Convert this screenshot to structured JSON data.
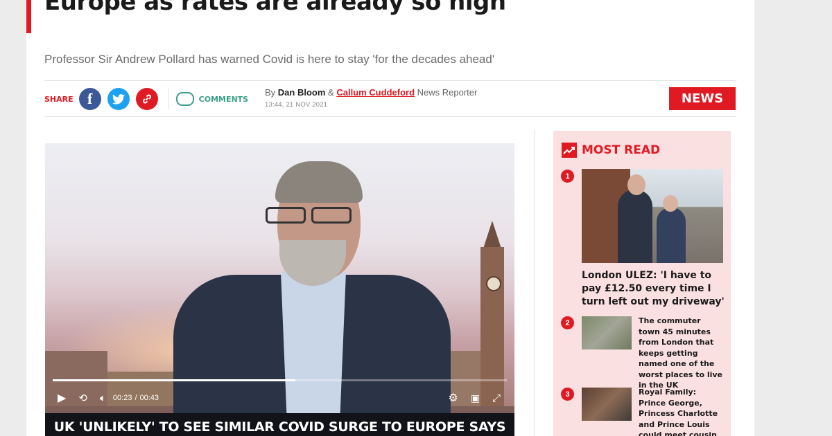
{
  "article": {
    "headline": "Europe as rates are already so high",
    "standfirst": "Professor Sir Andrew Pollard has warned Covid is here to stay 'for the decades ahead'",
    "share_label": "SHARE",
    "comments_label": "COMMENTS",
    "byline": {
      "prefix": "By",
      "author1": "Dan Bloom",
      "amp": "&",
      "author2": "Callum Cuddeford",
      "role": "News Reporter",
      "timestamp": "13:44, 21 NOV 2021"
    },
    "section_badge": "NEWS"
  },
  "video": {
    "current_time": "00:23",
    "separator": "/",
    "duration": "00:43",
    "progress": 0.535,
    "caption": "UK 'UNLIKELY' TO SEE SIMILAR COVID SURGE TO EUROPE SAYS",
    "icons": [
      "play-icon",
      "replay-10-icon",
      "volume-icon",
      "settings-icon",
      "picture-in-picture-icon",
      "fullscreen-icon"
    ]
  },
  "most_read": {
    "title": "MOST READ",
    "items": [
      {
        "number": "1",
        "headline": "London ULEZ: 'I have to pay £12.50 every time I turn left out my driveway'"
      },
      {
        "number": "2",
        "headline": "The commuter town 45 minutes from London that keeps getting named one of the worst places to live in the UK"
      },
      {
        "number": "3",
        "headline": "Royal Family: Prince George, Princess Charlotte and Prince Louis could meet cousin Lilibet soon"
      }
    ]
  },
  "colors": {
    "brand_red": "#e01a22",
    "facebook": "#3b5998",
    "twitter": "#1da1f2",
    "comments_green": "#3a9f87",
    "sidebar_bg": "#fbe0e2"
  }
}
